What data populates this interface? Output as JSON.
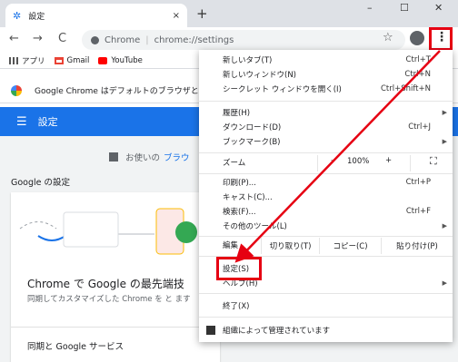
{
  "tab": {
    "title": "設定",
    "close": "×",
    "new_tab": "+"
  },
  "window": {
    "minimize": "–",
    "maximize": "☐",
    "close": "✕"
  },
  "toolbar": {
    "back": "←",
    "forward": "→",
    "reload": "C",
    "site_name": "Chrome",
    "separator": "|",
    "url": "chrome://settings",
    "star": "☆",
    "menu": "⋮"
  },
  "bookmarks": [
    {
      "label": "アプリ",
      "icon": "apps-grid-icon",
      "color": "#555555"
    },
    {
      "label": "Gmail",
      "icon": "gmail-icon",
      "color": "#ea4335"
    },
    {
      "label": "YouTube",
      "icon": "youtube-icon",
      "color": "#ff0000"
    }
  ],
  "infobar": {
    "text": "Google Chrome はデフォルトのブラウザと"
  },
  "settings": {
    "header_title": "設定",
    "managed_text": "お使いの",
    "managed_link": "ブラウ",
    "section_title": "Google の設定",
    "card_title": "Chrome で Google の最先端技",
    "card_desc": "同期してカスタマイズした Chrome を と ます",
    "sync_link": "同期と Google サービス"
  },
  "menu": {
    "items_top": [
      {
        "label": "新しいタブ(T)",
        "shortcut": "Ctrl+T"
      },
      {
        "label": "新しいウィンドウ(N)",
        "shortcut": "Ctrl+N"
      },
      {
        "label": "シークレット ウィンドウを開く(I)",
        "shortcut": "Ctrl+Shift+N"
      }
    ],
    "items_history": [
      {
        "label": "履歴(H)",
        "shortcut": ""
      },
      {
        "label": "ダウンロード(D)",
        "shortcut": "Ctrl+J"
      },
      {
        "label": "ブックマーク(B)",
        "shortcut": ""
      }
    ],
    "zoom": {
      "label": "ズーム",
      "minus": "–",
      "percent": "100%",
      "plus": "+",
      "fullscreen": "⛶"
    },
    "items_print": [
      {
        "label": "印刷(P)...",
        "shortcut": "Ctrl+P"
      },
      {
        "label": "キャスト(C)...",
        "shortcut": ""
      },
      {
        "label": "検索(F)...",
        "shortcut": "Ctrl+F"
      },
      {
        "label": "その他のツール(L)",
        "shortcut": ""
      }
    ],
    "edit": {
      "label": "編集",
      "cut": "切り取り(T)",
      "copy": "コピー(C)",
      "paste": "貼り付け(P)"
    },
    "settings_item": "設定(S)",
    "help_item": "ヘルプ(H)",
    "exit_item": "終了(X)",
    "managed_item": "組織によって管理されています"
  },
  "colors": {
    "accent": "#1a73e8",
    "highlight": "#e60012"
  }
}
